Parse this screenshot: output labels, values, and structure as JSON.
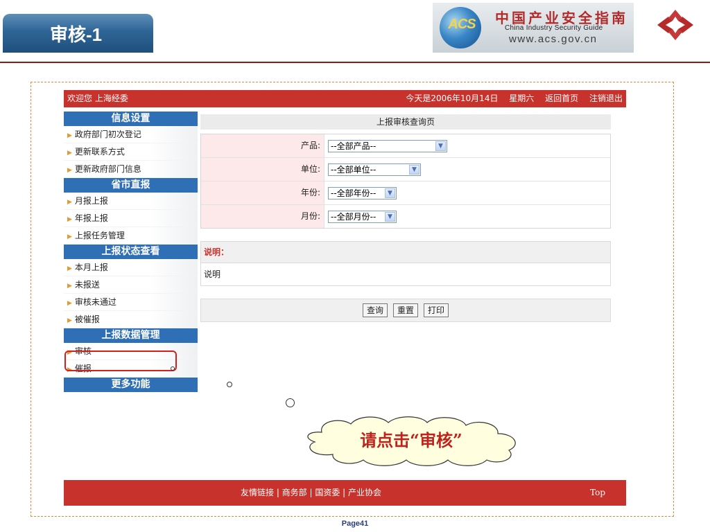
{
  "slide": {
    "title": "审核-1",
    "logo": {
      "acs": "ACS",
      "cn": "中国产业安全指南",
      "en": "China Industry Security Guide",
      "url": "www.acs.gov.cn"
    },
    "page_number": "Page41",
    "callout": "请点击“审核”",
    "colors": {
      "header_red": "#c8322c",
      "nav_blue": "#2f6fb5",
      "title_blue": "#2e6596"
    }
  },
  "topbar": {
    "welcome": "欢迎您 上海经委",
    "date": "今天是2006年10月14日",
    "weekday": "星期六",
    "home_link": "返回首页",
    "logout_link": "注销退出"
  },
  "sidebar": {
    "sections": [
      {
        "title": "信息设置",
        "items": [
          "政府部门初次登记",
          "更新联系方式",
          "更新政府部门信息"
        ]
      },
      {
        "title": "省市直报",
        "items": [
          "月报上报",
          "年报上报",
          "上报任务管理"
        ]
      },
      {
        "title": "上报状态查看",
        "items": [
          "本月上报",
          "未报送",
          "审核未通过",
          "被催报"
        ]
      },
      {
        "title": "上报数据管理",
        "items": [
          "审核",
          "催报"
        ]
      },
      {
        "title": "更多功能",
        "items": []
      }
    ]
  },
  "main": {
    "page_title": "上报审核查询页",
    "form": {
      "product": {
        "label": "产品:",
        "value": "--全部产品--"
      },
      "unit": {
        "label": "单位:",
        "value": "--全部单位--"
      },
      "year": {
        "label": "年份:",
        "value": "--全部年份--"
      },
      "month": {
        "label": "月份:",
        "value": "--全部月份--"
      }
    },
    "note_heading": "说明：",
    "note_text": "说明",
    "buttons": {
      "query": "查询",
      "reset": "重置",
      "print": "打印"
    }
  },
  "footer": {
    "links": "友情链接 | 商务部 | 国资委 | 产业协会",
    "top": "Top"
  }
}
